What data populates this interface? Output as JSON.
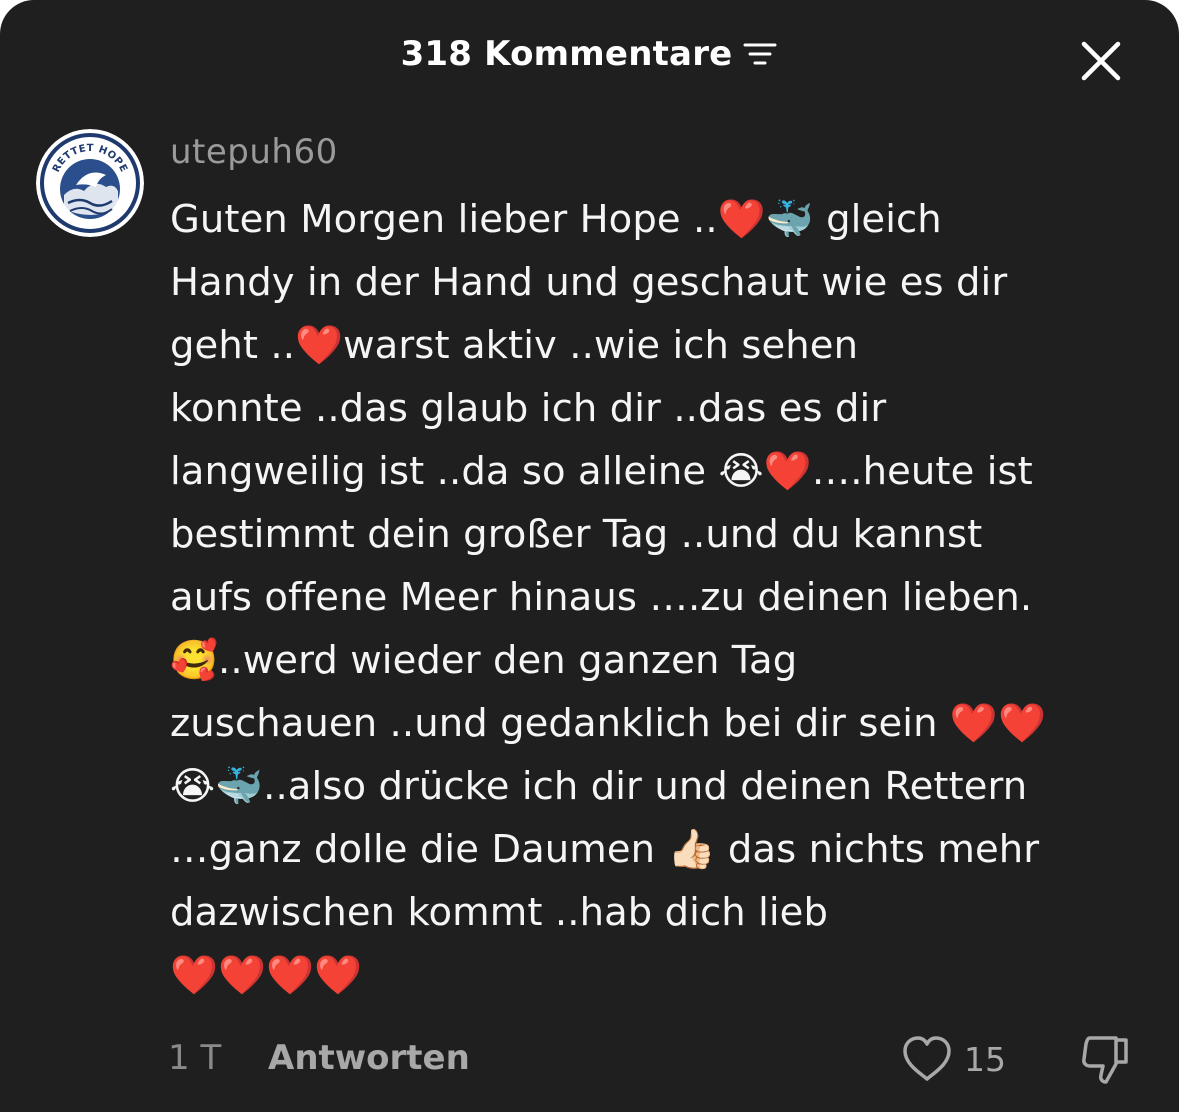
{
  "header": {
    "title": "318 Kommentare",
    "filter_icon": "sort-filter-icon",
    "close_icon": "close-icon"
  },
  "comment": {
    "username": "utepuh60",
    "avatar_icon": "rettet-hope-logo",
    "avatar_logo_text": "RETTET HOPE",
    "text": "Guten Morgen lieber Hope ..❤️🐳 gleich\nHandy in der Hand und geschaut wie es dir\ngeht ..❤️warst aktiv ..wie ich sehen\nkonnte ..das glaub ich dir ..das es dir\nlangweilig ist ..da so alleine 😭❤️….heute ist\nbestimmt dein großer Tag ..und du kannst\naufs offene Meer hinaus ….zu deinen lieben.\n🥰..werd wieder den ganzen Tag\nzuschauen ..und gedanklich bei dir sein ❤️❤️\n😭🐳..also drücke ich dir und deinen Rettern\n…ganz dolle die Daumen 👍🏻 das nichts mehr\ndazwischen kommt ..hab dich lieb\n❤️❤️❤️❤️",
    "timestamp": "1 T",
    "reply_label": "Antworten",
    "like_count": "15",
    "like_icon": "heart-outline-icon",
    "dislike_icon": "thumbs-down-icon"
  },
  "colors": {
    "background": "#1f1f1f",
    "text": "#f5f5f5",
    "muted": "#9a9a9a",
    "avatar_navy": "#1f3a6e"
  }
}
